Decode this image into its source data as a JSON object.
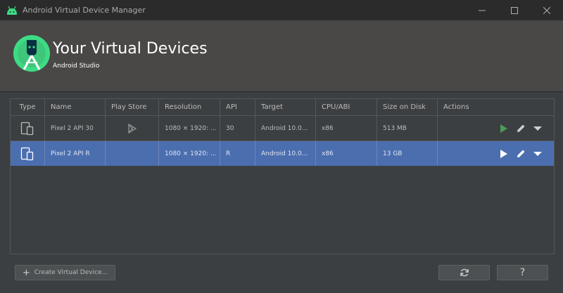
{
  "window": {
    "title": "Android Virtual Device Manager",
    "controls": [
      "minimize",
      "maximize",
      "close"
    ]
  },
  "header": {
    "title": "Your Virtual Devices",
    "subtitle": "Android Studio"
  },
  "table": {
    "columns": [
      "Type",
      "Name",
      "Play Store",
      "Resolution",
      "API",
      "Target",
      "CPU/ABI",
      "Size on Disk",
      "Actions"
    ],
    "rows": [
      {
        "type_icon": "phone-tablet-icon",
        "name": "Pixel 2 API 30",
        "play_store_icon": "play-store-icon",
        "resolution": "1080 × 1920: ...",
        "api": "30",
        "target": "Android 10.0...",
        "cpu": "x86",
        "size": "513 MB",
        "selected": false
      },
      {
        "type_icon": "phone-tablet-icon",
        "name": "Pixel 2 API R",
        "play_store_icon": "",
        "resolution": "1080 × 1920: ...",
        "api": "R",
        "target": "Android 10.0...",
        "cpu": "x86",
        "size": "13 GB",
        "selected": true
      }
    ]
  },
  "buttons": {
    "create": "Create Virtual Device...",
    "refresh_icon": "refresh-icon",
    "help": "?"
  },
  "colors": {
    "background": "#3c3f41",
    "titlebar": "#2b2b2b",
    "header": "#4a4847",
    "selection": "#4b6eaf",
    "run_green": "#499c54",
    "android_green": "#3ddc84"
  }
}
